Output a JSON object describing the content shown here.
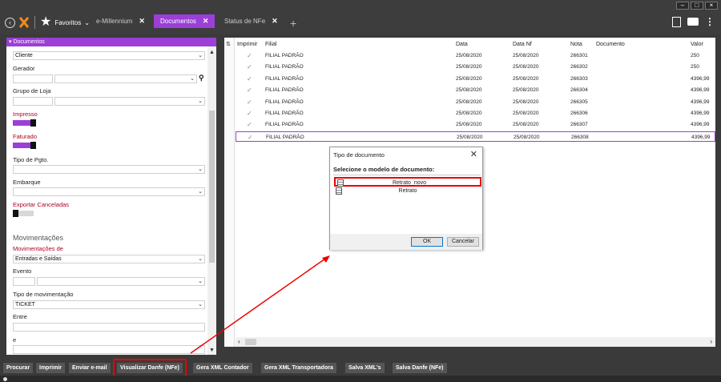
{
  "tabs": {
    "favorites": "Favoritos",
    "items": [
      {
        "label": "e-Millennium"
      },
      {
        "label": "Documentos"
      },
      {
        "label": "Status de NFe"
      }
    ]
  },
  "panel": {
    "title": "Documentos",
    "cliente": "Cliente",
    "gerador": "Gerador",
    "grupo_loja": "Grupo de Loja",
    "impresso": "Impresso",
    "faturado": "Faturado",
    "tipo_pgto": "Tipo de Pgto.",
    "embarque": "Embarque",
    "exportar_canceladas": "Exportar Canceladas",
    "movimentacoes": "Movimentações",
    "movimentacoes_de": "Movimentações de",
    "movimentacoes_de_value": "Entradas e Saídas",
    "evento": "Evento",
    "tipo_mov": "Tipo de movimentação",
    "tipo_mov_value": "TICKET",
    "entre": "Entre",
    "e": "e"
  },
  "grid": {
    "headers": {
      "imprimir": "Imprimir",
      "filial": "Filial",
      "data": "Data",
      "data_nf": "Data Nf",
      "nota": "Nota",
      "documento": "Documento",
      "valor": "Valor"
    },
    "rows": [
      {
        "filial": "FILIAL PADRÃO",
        "data": "25/08/2020",
        "data_nf": "25/08/2020",
        "nota": "266301",
        "valor": "250"
      },
      {
        "filial": "FILIAL PADRÃO",
        "data": "25/08/2020",
        "data_nf": "25/08/2020",
        "nota": "266302",
        "valor": "250"
      },
      {
        "filial": "FILIAL PADRÃO",
        "data": "25/08/2020",
        "data_nf": "25/08/2020",
        "nota": "266303",
        "valor": "4396,99"
      },
      {
        "filial": "FILIAL PADRÃO",
        "data": "25/08/2020",
        "data_nf": "25/08/2020",
        "nota": "266304",
        "valor": "4396,99"
      },
      {
        "filial": "FILIAL PADRÃO",
        "data": "25/08/2020",
        "data_nf": "25/08/2020",
        "nota": "266305",
        "valor": "4396,99"
      },
      {
        "filial": "FILIAL PADRÃO",
        "data": "25/08/2020",
        "data_nf": "25/08/2020",
        "nota": "266306",
        "valor": "4396,99"
      },
      {
        "filial": "FILIAL PADRÃO",
        "data": "25/08/2020",
        "data_nf": "25/08/2020",
        "nota": "266307",
        "valor": "4396,99"
      },
      {
        "filial": "FILIAL PADRÃO",
        "data": "25/08/2020",
        "data_nf": "25/08/2020",
        "nota": "266308",
        "valor": "4396,99"
      }
    ]
  },
  "dialog": {
    "title": "Tipo de documento",
    "subtitle": "Selecione o modelo de documento:",
    "items": [
      "Retrato_novo",
      "Retrato"
    ],
    "ok": "OK",
    "cancel": "Cancelar"
  },
  "toolbar": {
    "procurar": "Procurar",
    "imprimir": "Imprimir",
    "enviar_email": "Enviar e-mail",
    "visualizar_danfe": "Visualizar Danfe (NFe)",
    "gera_xml_contador": "Gera XML Contador",
    "gera_xml_transportadora": "Gera XML Transportadora",
    "salva_xmls": "Salva XML's",
    "salva_danfe": "Salva Danfe (NFe)"
  },
  "colors": {
    "accent": "#9b3fd6",
    "highlight": "#e00000"
  }
}
